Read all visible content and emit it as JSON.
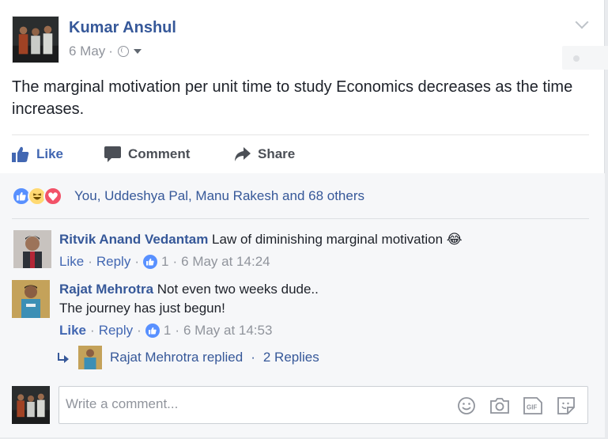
{
  "post": {
    "author": "Kumar Anshul",
    "date": "6 May",
    "separator": "·",
    "text": "The marginal motivation per unit time to study Economics decreases as the time increases."
  },
  "actions": {
    "like": "Like",
    "comment": "Comment",
    "share": "Share"
  },
  "reactions": {
    "icons": [
      "like-icon",
      "haha-icon",
      "love-icon"
    ],
    "summary": "You, Uddeshya Pal, Manu Rakesh and 68 others"
  },
  "comments": [
    {
      "name": "Ritvik Anand Vedantam",
      "text": "Law of diminishing marginal motivation",
      "emoji": "😂",
      "like": "Like",
      "reply": "Reply",
      "likes": "1",
      "time": "6 May at 14:24"
    },
    {
      "name": "Rajat Mehrotra",
      "text_line1": "Not even two weeks dude..",
      "text_line2": "The journey has just begun!",
      "like": "Like",
      "reply": "Reply",
      "likes": "1",
      "time": "6 May at 14:53"
    }
  ],
  "reply_summary": {
    "replier": "Rajat Mehrotra replied",
    "separator": "·",
    "count": "2 Replies"
  },
  "composer": {
    "placeholder": "Write a comment...",
    "tools": [
      "emoji-icon",
      "camera-icon",
      "gif-icon",
      "sticker-icon"
    ],
    "gif_label": "GIF"
  },
  "colors": {
    "link": "#365899",
    "accent": "#4267b2",
    "muted": "#90949c"
  }
}
